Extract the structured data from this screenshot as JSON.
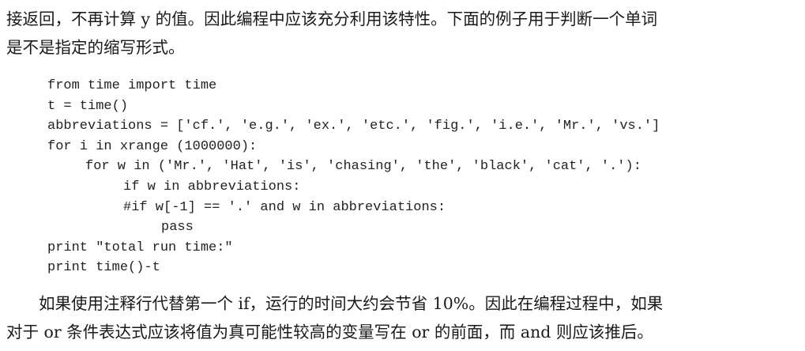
{
  "paragraph_top": {
    "line1": "接返回，不再计算 y 的值。因此编程中应该充分利用该特性。下面的例子用于判断一个单词",
    "line2": "是不是指定的缩写形式。"
  },
  "code": {
    "lines": [
      "from time import time",
      "t = time()",
      "abbreviations = ['cf.', 'e.g.', 'ex.', 'etc.', 'fig.', 'i.e.', 'Mr.', 'vs.']",
      "for i in xrange (1000000):",
      "for w in ('Mr.', 'Hat', 'is', 'chasing', 'the', 'black', 'cat', '.'):",
      "if w in abbreviations:",
      "#if w[-1] == '.' and w in abbreviations:",
      "pass",
      "print \"total run time:\"",
      "print time()-t"
    ]
  },
  "paragraph_bottom": {
    "line1": "如果使用注释行代替第一个 if，运行的时间大约会节省 10%。因此在编程过程中，如果",
    "line2": "对于 or 条件表达式应该将值为真可能性较高的变量写在 or 的前面，而 and 则应该推后。"
  }
}
